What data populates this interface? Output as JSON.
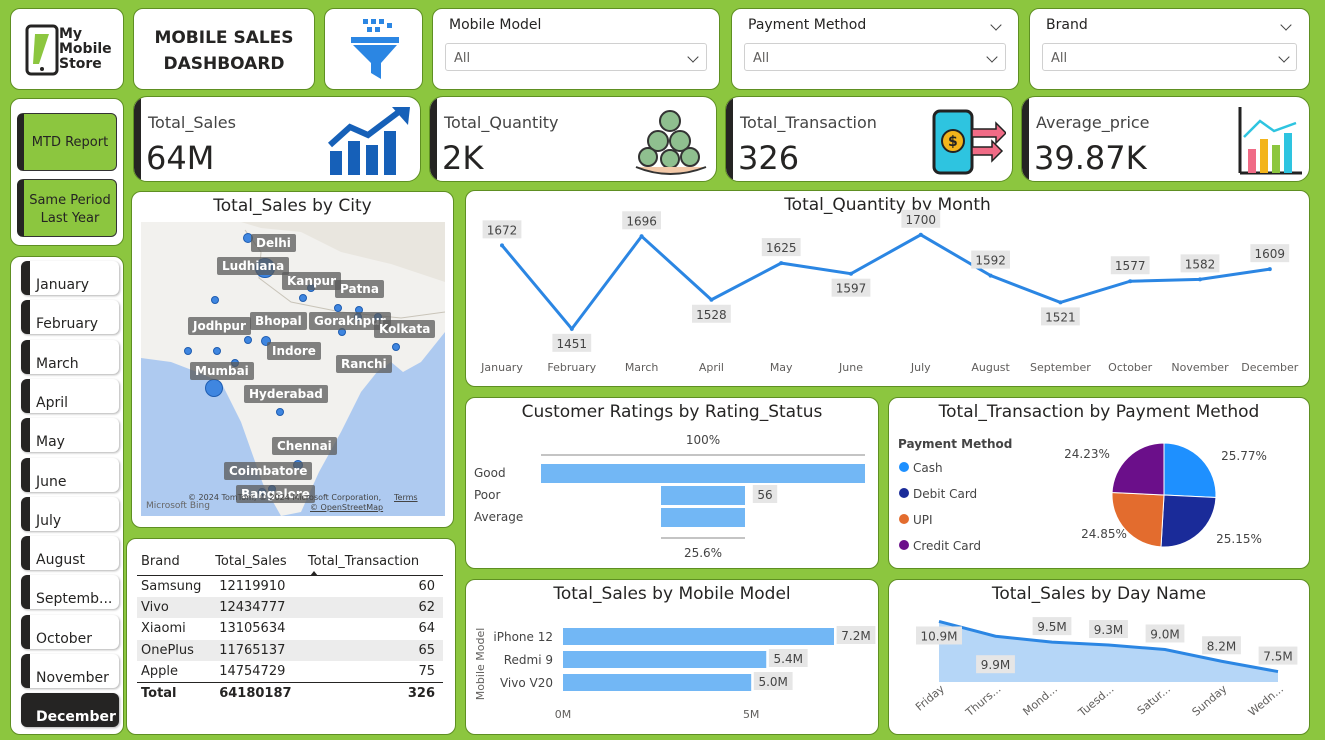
{
  "logo": {
    "line1": "My",
    "line2": "Mobile",
    "line3": "Store"
  },
  "header": {
    "title_line1": "MOBILE SALES",
    "title_line2": "DASHBOARD"
  },
  "slicers": [
    {
      "title": "Mobile Model",
      "value": "All"
    },
    {
      "title": "Payment Method",
      "value": "All"
    },
    {
      "title": "Brand",
      "value": "All"
    }
  ],
  "report_buttons": {
    "mtd": "MTD Report",
    "spl_line1": "Same Period",
    "spl_line2": "Last Year"
  },
  "kpis": [
    {
      "label": "Total_Sales",
      "value": "64M",
      "icon": "growth-chart-icon"
    },
    {
      "label": "Total_Quantity",
      "value": "2K",
      "icon": "money-bags-icon"
    },
    {
      "label": "Total_Transaction",
      "value": "326",
      "icon": "phone-payment-icon"
    },
    {
      "label": "Average_price",
      "value": "39.87K",
      "icon": "bar-chart-icon"
    }
  ],
  "months": [
    "January",
    "February",
    "March",
    "April",
    "May",
    "June",
    "July",
    "August",
    "Septemb...",
    "October",
    "November",
    "December"
  ],
  "selected_month": "December",
  "map": {
    "title": "Total_Sales by City",
    "cities": [
      "Delhi",
      "Ludhiana",
      "Kanpur",
      "Patna",
      "Jodhpur",
      "Bhopal",
      "Gorakhpur",
      "Kolkata",
      "Indore",
      "Ranchi",
      "Mumbai",
      "Hyderabad",
      "Chennai",
      "Coimbatore",
      "Bangalore"
    ],
    "attribution": "© 2024 TomTom, © 2024 Microsoft Corporation,",
    "terms": "Terms",
    "osm": "© OpenStreetMap",
    "bing": "Microsoft Bing"
  },
  "brand_table": {
    "headers": [
      "Brand",
      "Total_Sales",
      "Total_Transaction"
    ],
    "rows": [
      [
        "Samsung",
        "12119910",
        "60"
      ],
      [
        "Vivo",
        "12434777",
        "62"
      ],
      [
        "Xiaomi",
        "13105634",
        "64"
      ],
      [
        "OnePlus",
        "11765137",
        "65"
      ],
      [
        "Apple",
        "14754729",
        "75"
      ]
    ],
    "total": [
      "Total",
      "64180187",
      "326"
    ]
  },
  "chart_data": [
    {
      "type": "line",
      "title": "Total_Quantity by Month",
      "categories": [
        "January",
        "February",
        "March",
        "April",
        "May",
        "June",
        "July",
        "August",
        "September",
        "October",
        "November",
        "December"
      ],
      "values": [
        1672,
        1451,
        1696,
        1528,
        1625,
        1597,
        1700,
        1592,
        1521,
        1577,
        1582,
        1609
      ],
      "color": "#2b86e3"
    },
    {
      "type": "bar",
      "title": "Customer Ratings by Rating_Status",
      "categories": [
        "Good",
        "Poor",
        "Average"
      ],
      "values": [
        100,
        56,
        56
      ],
      "value_labels": [
        "",
        "56",
        ""
      ],
      "top_label": "100%",
      "bottom_label": "25.6%",
      "color": "#72b7f5"
    },
    {
      "type": "pie",
      "title": "Total_Transaction by Payment Method",
      "legend_title": "Payment Method",
      "categories": [
        "Cash",
        "Debit Card",
        "UPI",
        "Credit Card"
      ],
      "values": [
        25.77,
        25.15,
        24.85,
        24.23
      ],
      "labels": [
        "25.77%",
        "25.15%",
        "24.85%",
        "24.23%"
      ],
      "colors": [
        "#1e90ff",
        "#1a2b99",
        "#e36c2e",
        "#6b0f8a"
      ]
    },
    {
      "type": "bar",
      "title": "Total_Sales by Mobile Model",
      "ylabel": "Mobile Model",
      "categories": [
        "iPhone 12",
        "Redmi 9",
        "Vivo V20"
      ],
      "values": [
        7.2,
        5.4,
        5.0
      ],
      "value_labels": [
        "7.2M",
        "5.4M",
        "5.0M"
      ],
      "ticks": [
        "0M",
        "5M"
      ],
      "color": "#72b7f5"
    },
    {
      "type": "area",
      "title": "Total_Sales by Day Name",
      "categories": [
        "Friday",
        "Thurs...",
        "Mond...",
        "Tuesd...",
        "Satur...",
        "Sunday",
        "Wedn..."
      ],
      "values": [
        10.9,
        9.9,
        9.5,
        9.3,
        9.0,
        8.2,
        7.5
      ],
      "value_labels": [
        "10.9M",
        "9.9M",
        "9.5M",
        "9.3M",
        "9.0M",
        "8.2M",
        "7.5M"
      ],
      "color": "#2b86e3"
    }
  ]
}
